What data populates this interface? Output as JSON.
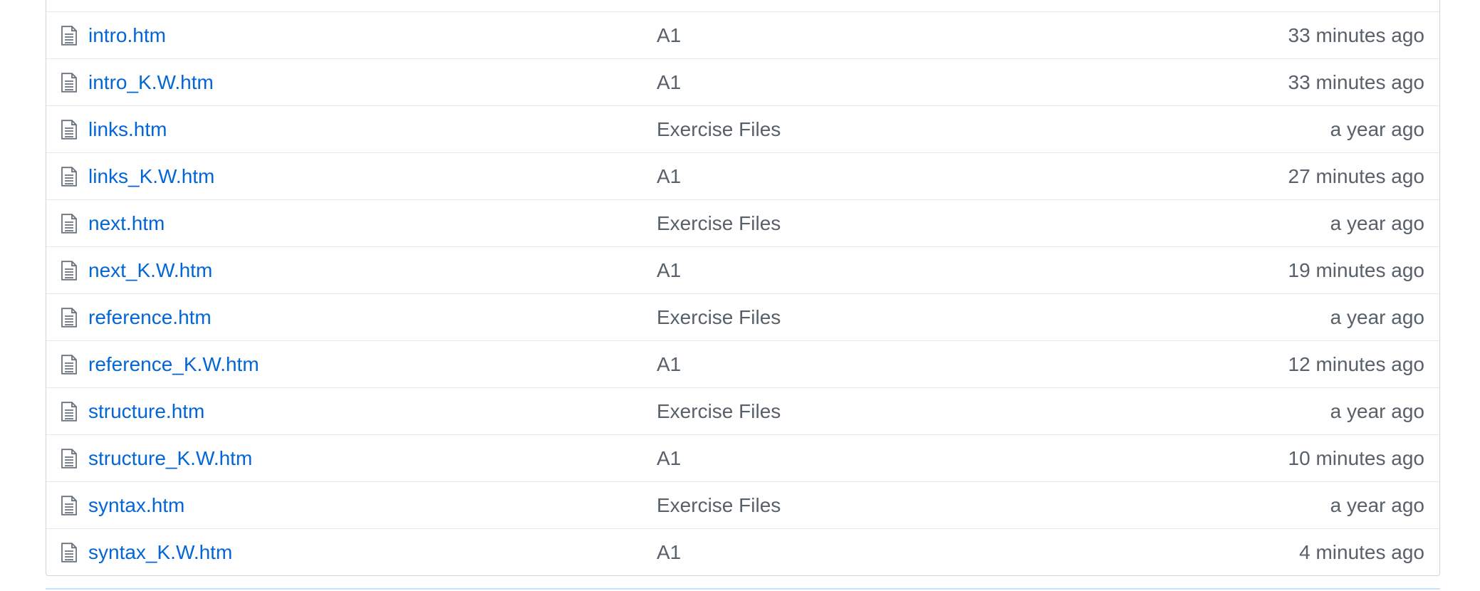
{
  "files": [
    {
      "name": "intro.htm",
      "message": "A1",
      "age": "33 minutes ago"
    },
    {
      "name": "intro_K.W.htm",
      "message": "A1",
      "age": "33 minutes ago"
    },
    {
      "name": "links.htm",
      "message": "Exercise Files",
      "age": "a year ago"
    },
    {
      "name": "links_K.W.htm",
      "message": "A1",
      "age": "27 minutes ago"
    },
    {
      "name": "next.htm",
      "message": "Exercise Files",
      "age": "a year ago"
    },
    {
      "name": "next_K.W.htm",
      "message": "A1",
      "age": "19 minutes ago"
    },
    {
      "name": "reference.htm",
      "message": "Exercise Files",
      "age": "a year ago"
    },
    {
      "name": "reference_K.W.htm",
      "message": "A1",
      "age": "12 minutes ago"
    },
    {
      "name": "structure.htm",
      "message": "Exercise Files",
      "age": "a year ago"
    },
    {
      "name": "structure_K.W.htm",
      "message": "A1",
      "age": "10 minutes ago"
    },
    {
      "name": "syntax.htm",
      "message": "Exercise Files",
      "age": "a year ago"
    },
    {
      "name": "syntax_K.W.htm",
      "message": "A1",
      "age": "4 minutes ago"
    }
  ],
  "icons": {
    "file": "file-text-icon"
  },
  "colors": {
    "link": "#0366d6",
    "muted": "#586069",
    "border": "#d1d5da"
  }
}
